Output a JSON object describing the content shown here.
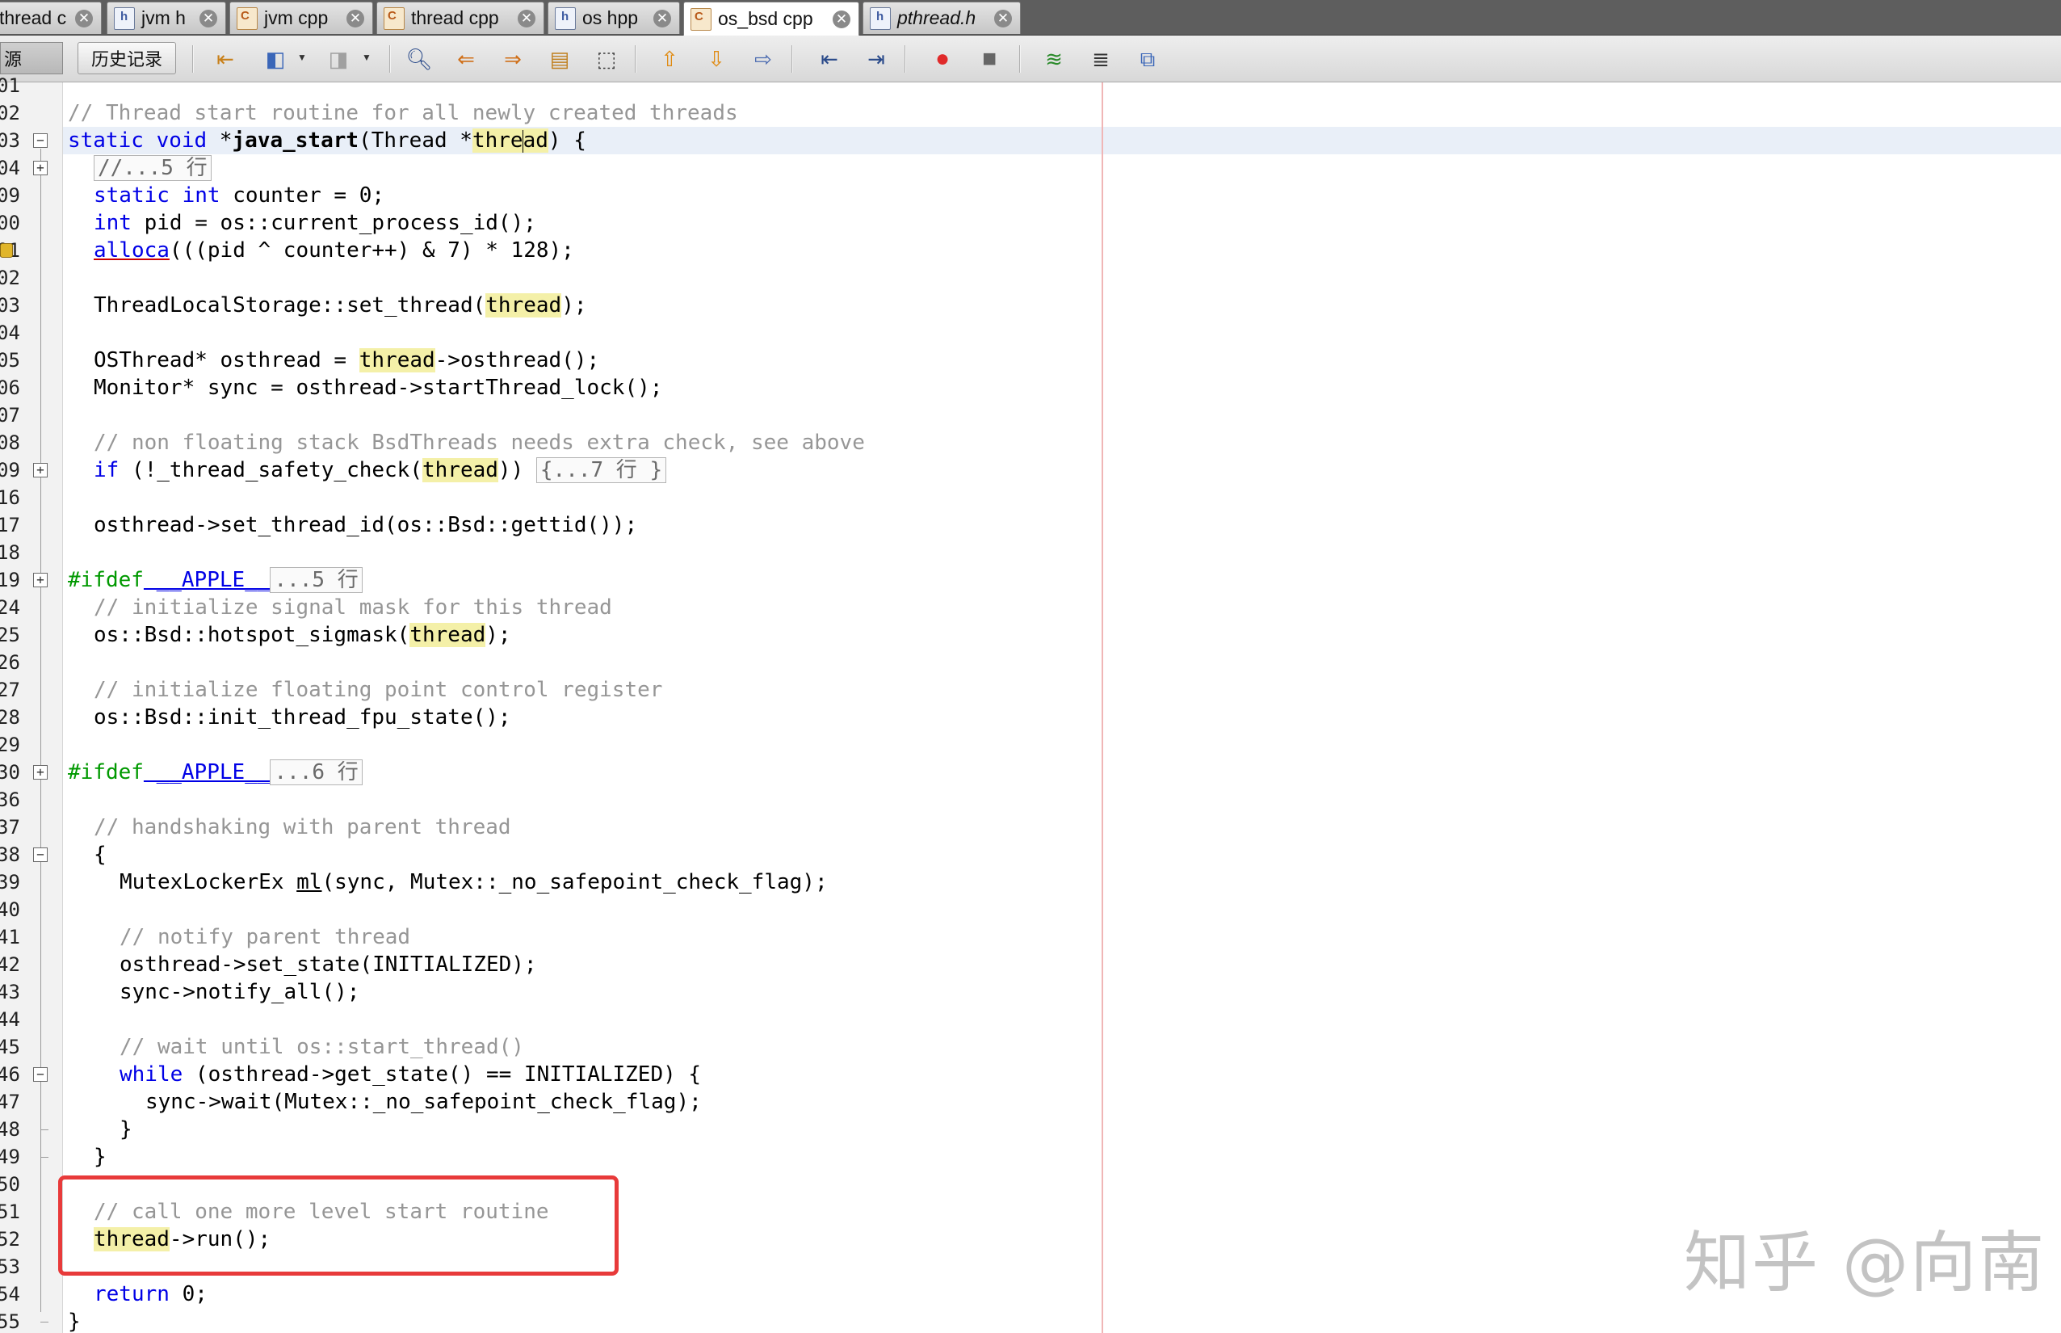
{
  "tabs": [
    {
      "label": "thread c"
    },
    {
      "label": "jvm h"
    },
    {
      "label": "jvm cpp"
    },
    {
      "label": "thread cpp"
    },
    {
      "label": "os hpp"
    },
    {
      "label": "os_bsd cpp"
    },
    {
      "label": "pthread.h"
    }
  ],
  "toolbar": {
    "source_label": "源",
    "history_label": "历史记录"
  },
  "gutter": {
    "line_numbers": [
      "01",
      "02",
      "03",
      "04",
      "09",
      "00",
      "01",
      "02",
      "03",
      "04",
      "05",
      "06",
      "07",
      "08",
      "09",
      "16",
      "17",
      "18",
      "19",
      "24",
      "25",
      "26",
      "27",
      "28",
      "29",
      "30",
      "36",
      "37",
      "38",
      "39",
      "40",
      "41",
      "42",
      "43",
      "44",
      "45",
      "46",
      "47",
      "48",
      "49",
      "50",
      "51",
      "52",
      "53",
      "54",
      "55"
    ]
  },
  "code": {
    "l_comment_start": "// Thread start routine for all newly created threads",
    "l_static": "static",
    "l_void": "void",
    "l_ptr": "*",
    "l_func": "java_start",
    "l_params_a": "(Thread *",
    "l_param_hl_a": "thre",
    "l_param_hl_b": "ad",
    "l_params_b": ") {",
    "l_fold1": "//...5 行",
    "l_static2": "static",
    "l_int": "int",
    "l_counter": " counter = 0;",
    "l_int2": "int",
    "l_pid": " pid = os::current_process_id();",
    "l_alloca": "alloca",
    "l_alloca_rest": "(((pid ^ counter++) & 7) * 128);",
    "l_tls_a": "ThreadLocalStorage::set_thread(",
    "l_thread": "thread",
    "l_tls_b": ");",
    "l_os_a": "OSThread* osthread = ",
    "l_os_b": "->osthread();",
    "l_mon": "Monitor* sync = osthread->startThread_lock();",
    "l_comment_nonfloat": "// non floating stack BsdThreads needs extra check, see above",
    "l_if": "if",
    "l_if_a": " (!_thread_safety_check(",
    "l_if_b": ")) ",
    "l_fold2": "{...7 行 }",
    "l_setid": "osthread->set_thread_id(os::Bsd::gettid());",
    "l_ifdef": "#ifdef",
    "l_apple": " __APPLE__",
    "l_fold3": "...5 行",
    "l_comment_sig": "// initialize signal mask for this thread",
    "l_sig_a": "os::Bsd::hotspot_sigmask(",
    "l_sig_b": ");",
    "l_comment_fpu": "// initialize floating point control register",
    "l_fpu": "os::Bsd::init_thread_fpu_state();",
    "l_ifdef2": "#ifdef",
    "l_apple2": " __APPLE__",
    "l_fold4": "...6 行",
    "l_comment_hand": "// handshaking with parent thread",
    "l_brace_open": "{",
    "l_mutex_a": "MutexLockerEx ",
    "l_mutex_ml": "ml",
    "l_mutex_b": "(sync, Mutex::_no_safepoint_check_flag);",
    "l_comment_notify": "// notify parent thread",
    "l_setstate": "osthread->set_state(INITIALIZED);",
    "l_notify": "sync->notify_all();",
    "l_comment_wait": "// wait until os::start_thread()",
    "l_while": "while",
    "l_while_rest": " (osthread->get_state() == INITIALIZED) {",
    "l_wait": "sync->wait(Mutex::_no_safepoint_check_flag);",
    "l_brace_close_inner": "}",
    "l_brace_close": "}",
    "l_comment_call": "// call one more level start routine",
    "l_run": "->run();",
    "l_return": "return",
    "l_return_rest": " 0;",
    "l_func_close": "}"
  },
  "watermark": "知乎 @向南",
  "colors": {
    "keyword": "#0000e6",
    "comment": "#969696",
    "preprocessor": "#009900",
    "highlight": "#f4f0a8",
    "annotation_box": "#e83a3a"
  }
}
